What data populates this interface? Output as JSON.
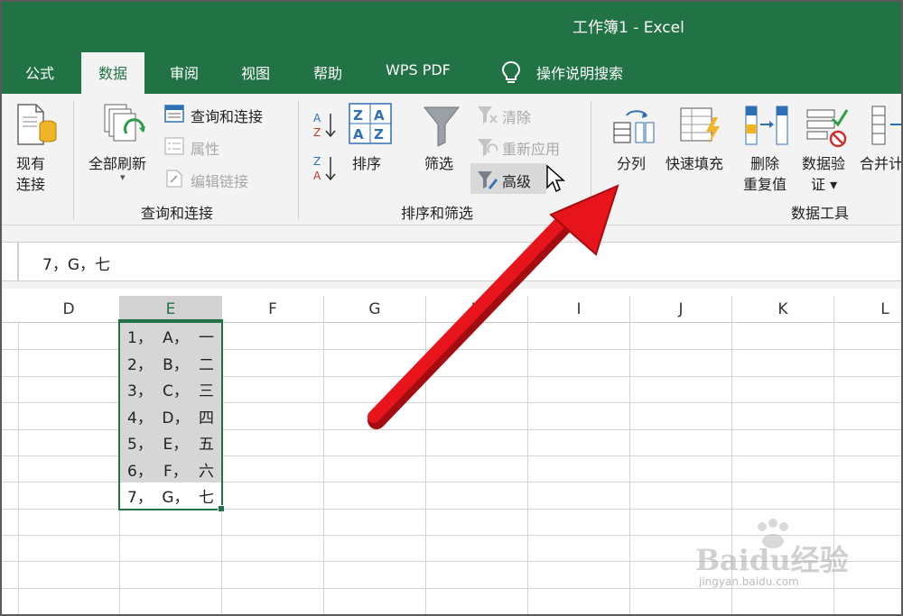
{
  "window": {
    "title": "工作簿1  -  Excel"
  },
  "tabs": [
    {
      "label": "公式"
    },
    {
      "label": "数据",
      "active": true
    },
    {
      "label": "审阅"
    },
    {
      "label": "视图"
    },
    {
      "label": "帮助"
    },
    {
      "label": "WPS PDF"
    },
    {
      "label": "操作说明搜索"
    }
  ],
  "ribbon": {
    "existing_connections": {
      "line1": "现有",
      "line2": "连接"
    },
    "refresh_all": "全部刷新",
    "queries_connections": "查询和连接",
    "properties": "属性",
    "edit_links": "编辑链接",
    "group_queries": "查询和连接",
    "sort": "排序",
    "filter": "筛选",
    "clear": "清除",
    "reapply": "重新应用",
    "advanced": "高级",
    "group_sort_filter": "排序和筛选",
    "text_to_columns": "分列",
    "flash_fill": "快速填充",
    "remove_duplicates": {
      "line1": "删除",
      "line2": "重复值"
    },
    "data_validation": {
      "line1": "数据验",
      "line2": "证 ▾"
    },
    "consolidate": "合并计",
    "group_data_tools": "数据工具"
  },
  "formula_bar": {
    "value": "7，G，七"
  },
  "columns": [
    "D",
    "E",
    "F",
    "G",
    "H",
    "I",
    "J",
    "K",
    "L"
  ],
  "selected_column": "E",
  "cells": [
    {
      "num": "1，",
      "letter": "A，",
      "cn": "一",
      "highlighted": true
    },
    {
      "num": "2，",
      "letter": "B，",
      "cn": "二",
      "highlighted": true
    },
    {
      "num": "3，",
      "letter": "C，",
      "cn": "三",
      "highlighted": true
    },
    {
      "num": "4，",
      "letter": "D，",
      "cn": "四",
      "highlighted": true
    },
    {
      "num": "5，",
      "letter": "E，",
      "cn": "五",
      "highlighted": true
    },
    {
      "num": "6，",
      "letter": "F，",
      "cn": "六",
      "highlighted": true
    },
    {
      "num": "7，",
      "letter": "G，",
      "cn": "七",
      "highlighted": false
    }
  ],
  "colors": {
    "excel_green": "#217346",
    "arrow_red": "#e8141b",
    "selection_gray": "#d6d6d6"
  },
  "watermark": {
    "brand": "Baidu经验",
    "url": "jingyan.baidu.com"
  }
}
